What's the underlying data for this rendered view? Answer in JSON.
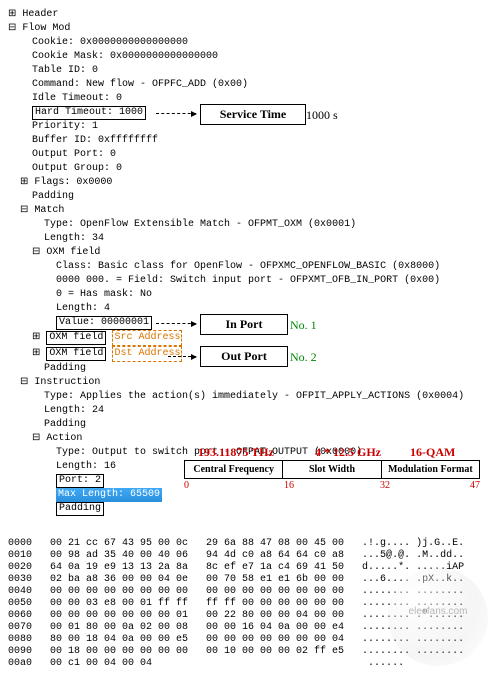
{
  "tree": {
    "header": "Header",
    "flowmod_label": "Flow Mod",
    "cookie": "Cookie: 0x0000000000000000",
    "cookie_mask": "Cookie Mask: 0x0000000000000000",
    "table_id": "Table ID: 0",
    "command": "Command: New flow - OFPFC_ADD (0x00)",
    "idle_timeout": "Idle Timeout: 0",
    "hard_timeout": "Hard Timeout: 1000",
    "priority": "Priority: 1",
    "buffer_id": "Buffer ID: 0xffffffff",
    "output_port": "Output Port: 0",
    "output_group": "Output Group: 0",
    "flags": "Flags: 0x0000",
    "padding1": "Padding",
    "match_label": "Match",
    "match_type": "Type: OpenFlow Extensible Match - OFPMT_OXM (0x0001)",
    "match_length": "Length: 34",
    "oxm_field_label": "OXM field",
    "oxm_class": "Class: Basic class for OpenFlow - OFPXMC_OPENFLOW_BASIC (0x8000)",
    "oxm_field_bits": "0000 000. = Field: Switch input port - OFPXMT_OFB_IN_PORT (0x00)",
    "oxm_hasmask": "0 = Has mask: No",
    "oxm_length": "Length: 4",
    "oxm_value": "Value: 00000001",
    "oxm_field_src": "OXM field",
    "oxm_field_dst": "OXM field",
    "src_addr": "Src Address",
    "dst_addr": "Dst Address",
    "padding2": "Padding",
    "instruction_label": "Instruction",
    "instr_type": "Type: Applies the action(s) immediately - OFPIT_APPLY_ACTIONS (0x0004)",
    "instr_length": "Length: 24",
    "instr_padding": "Padding",
    "action_label": "Action",
    "action_type": "Type: Output to switch port - OFPAT_OUTPUT (0x0000)",
    "action_length": "Length: 16",
    "action_port": "Port: 2",
    "action_maxlen": "Max Length: 65509",
    "action_padding": "Padding"
  },
  "ann": {
    "service_time_label": "Service Time",
    "service_time_val": "1000 s",
    "in_port_label": "In Port",
    "in_port_val": "No. 1",
    "out_port_label": "Out Port",
    "out_port_val": "No. 2",
    "table_h0": "Central Frequency",
    "table_h1": "Slot Width",
    "table_h2": "Modulation Format",
    "red0": "193.11875 THz",
    "red1": "4 * 12.5 GHz",
    "red2": "16-QAM",
    "ruler_0": "0",
    "ruler_1": "16",
    "ruler_2": "32",
    "ruler_3": "47"
  },
  "hex": {
    "lines": [
      "0000   00 21 cc 67 43 95 00 0c   29 6a 88 47 08 00 45 00   .!.g.... )j.G..E.",
      "0010   00 98 ad 35 40 00 40 06   94 4d c0 a8 64 64 c0 a8   ...5@.@. .M..dd..",
      "0020   64 0a 19 e9 13 13 2a 8a   8c ef e7 1a c4 69 41 50   d.....*. .....iAP",
      "0030   02 ba a8 36 00 00 04 0e   00 70 58 e1 e1 6b 00 00   ...6.... .pX..k..",
      "0040   00 00 00 00 00 00 00 00   00 00 00 00 00 00 00 00   ........ ........",
      "0050   00 00 03 e8 00 01 ff ff   ff ff 00 00 00 00 00 00   ........ ........",
      "0060   00 00 00 00 00 00 00 01   00 22 80 00 00 04 00 00   ........ .\"......",
      "0070   00 01 80 00 0a 02 00 08   00 00 16 04 0a 00 00 e4   ........ ........",
      "0080   80 00 18 04 0a 00 00 e5   00 00 00 00 00 00 00 04   ........ ........",
      "0090   00 18 00 00 00 00 00 00   00 10 00 00 00 02 ff e5   ........ ........",
      "00a0   00 c1 00 04 00 04                                    ......"
    ]
  },
  "watermark": "elecfans.com"
}
